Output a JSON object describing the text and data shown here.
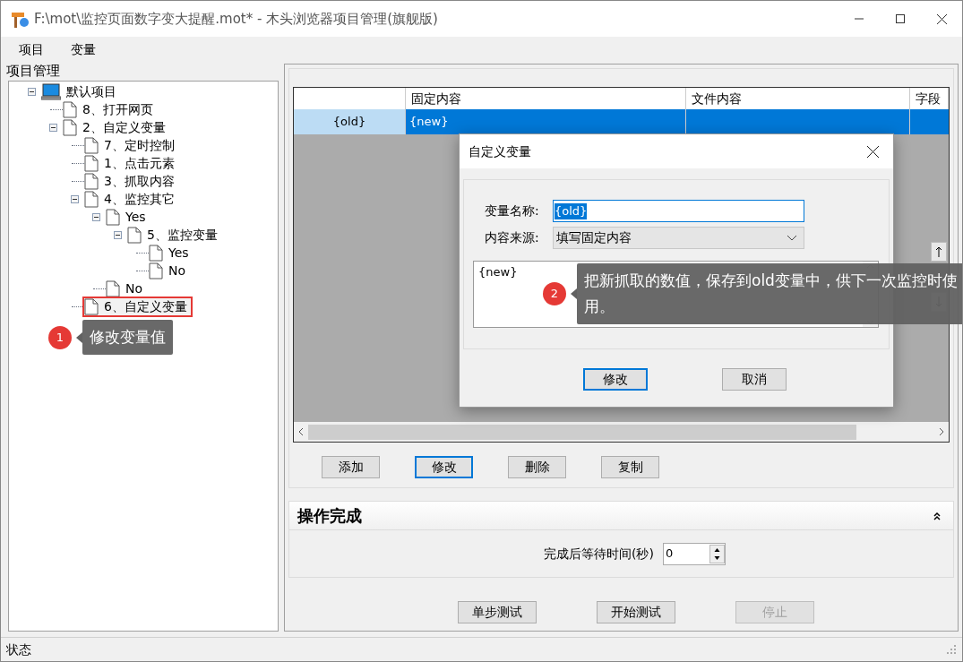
{
  "window": {
    "title": "F:\\mot\\监控页面数字变大提醒.mot* - 木头浏览器项目管理(旗舰版)"
  },
  "menu": [
    {
      "label": "项目"
    },
    {
      "label": "变量"
    }
  ],
  "project_panel": {
    "title": "项目管理",
    "tree": [
      {
        "label": "默认项目",
        "kind": "project",
        "expanded": true,
        "children": [
          {
            "label": "8、打开网页",
            "kind": "step"
          },
          {
            "label": "2、自定义变量",
            "kind": "step",
            "expanded": true,
            "children": [
              {
                "label": "7、定时控制",
                "kind": "step"
              },
              {
                "label": "1、点击元素",
                "kind": "step"
              },
              {
                "label": "3、抓取内容",
                "kind": "step"
              },
              {
                "label": "4、监控其它",
                "kind": "step",
                "expanded": true,
                "children": [
                  {
                    "label": "Yes",
                    "kind": "step",
                    "expanded": true,
                    "children": [
                      {
                        "label": "5、监控变量",
                        "kind": "step",
                        "expanded": true,
                        "children": [
                          {
                            "label": "Yes",
                            "kind": "step"
                          },
                          {
                            "label": "No",
                            "kind": "step"
                          }
                        ]
                      }
                    ]
                  },
                  {
                    "label": "No",
                    "kind": "step"
                  }
                ]
              },
              {
                "label": "6、自定义变量",
                "kind": "step",
                "highlighted": true
              }
            ]
          }
        ]
      }
    ]
  },
  "grid": {
    "columns": [
      "固定内容",
      "文件内容",
      "字段"
    ],
    "rows": [
      {
        "label": "{old}",
        "fixed_content": "{new}",
        "selected": true
      }
    ]
  },
  "grid_buttons": [
    {
      "label": "添加",
      "focused": false
    },
    {
      "label": "修改",
      "focused": true
    },
    {
      "label": "删除",
      "focused": false
    },
    {
      "label": "复制",
      "focused": false
    }
  ],
  "section": {
    "title": "操作完成",
    "expanded": true,
    "wait_label": "完成后等待时间(秒)",
    "wait_value": "0"
  },
  "test_buttons": [
    {
      "label": "单步测试",
      "disabled": false
    },
    {
      "label": "开始测试",
      "disabled": false
    },
    {
      "label": "停止",
      "disabled": true
    }
  ],
  "status_bar": {
    "text": "状态"
  },
  "dialog": {
    "title": "自定义变量",
    "name_label": "变量名称:",
    "name_value": "{old}",
    "source_label": "内容来源:",
    "source_value": "填写固定内容",
    "content_value": "{new}",
    "buttons": [
      {
        "label": "修改",
        "focused": true
      },
      {
        "label": "取消",
        "focused": false
      }
    ]
  },
  "annotations": [
    {
      "number": "1",
      "text": "修改变量值"
    },
    {
      "number": "2",
      "text": "把新抓取的数值，保存到old变量中，供下一次监控时使用。"
    }
  ]
}
